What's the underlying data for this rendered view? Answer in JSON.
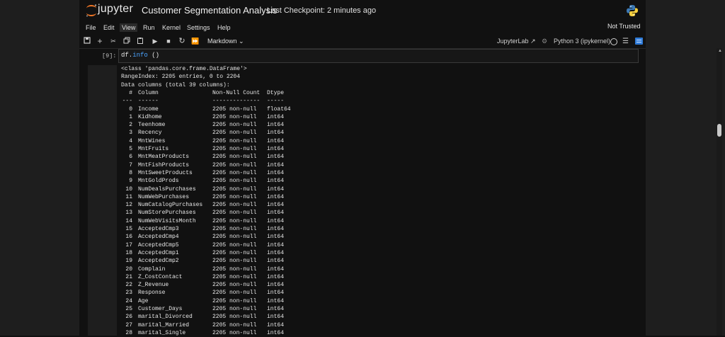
{
  "app": {
    "logo_text": "jupyter",
    "notebook_title": "Customer Segmentation Analysis",
    "checkpoint": "Last Checkpoint: 2 minutes ago"
  },
  "menu": [
    "File",
    "Edit",
    "View",
    "Run",
    "Kernel",
    "Settings",
    "Help"
  ],
  "active_menu": "View",
  "trust_status": "Not Trusted",
  "toolbar": {
    "icons": [
      "save-icon",
      "add-cell-icon",
      "cut-icon",
      "copy-icon",
      "paste-icon",
      "run-icon",
      "stop-icon",
      "restart-icon",
      "fast-forward-icon"
    ],
    "cell_type": "Markdown",
    "jupyterlab_link": "JupyterLab",
    "kernel_name": "Python 3 (ipykernel)"
  },
  "cell": {
    "prompt": "[9]:",
    "code_obj": "df.",
    "code_attr": "info",
    "code_call": " ()"
  },
  "output": {
    "header_lines": [
      "<class 'pandas.core.frame.DataFrame'>",
      "RangeIndex: 2205 entries, 0 to 2204",
      "Data columns (total 39 columns):"
    ],
    "col_header": {
      "num": " #",
      "name": "Column",
      "nn": "Non-Null Count",
      "dtype": "Dtype"
    },
    "col_sep": {
      "num": "---",
      "name": "------",
      "nn": "--------------",
      "dtype": "-----"
    },
    "rows": [
      {
        "num": "0",
        "name": "Income",
        "nn": "2205 non-null",
        "dtype": "float64"
      },
      {
        "num": "1",
        "name": "Kidhome",
        "nn": "2205 non-null",
        "dtype": "int64"
      },
      {
        "num": "2",
        "name": "Teenhome",
        "nn": "2205 non-null",
        "dtype": "int64"
      },
      {
        "num": "3",
        "name": "Recency",
        "nn": "2205 non-null",
        "dtype": "int64"
      },
      {
        "num": "4",
        "name": "MntWines",
        "nn": "2205 non-null",
        "dtype": "int64"
      },
      {
        "num": "5",
        "name": "MntFruits",
        "nn": "2205 non-null",
        "dtype": "int64"
      },
      {
        "num": "6",
        "name": "MntMeatProducts",
        "nn": "2205 non-null",
        "dtype": "int64"
      },
      {
        "num": "7",
        "name": "MntFishProducts",
        "nn": "2205 non-null",
        "dtype": "int64"
      },
      {
        "num": "8",
        "name": "MntSweetProducts",
        "nn": "2205 non-null",
        "dtype": "int64"
      },
      {
        "num": "9",
        "name": "MntGoldProds",
        "nn": "2205 non-null",
        "dtype": "int64"
      },
      {
        "num": "10",
        "name": "NumDealsPurchases",
        "nn": "2205 non-null",
        "dtype": "int64"
      },
      {
        "num": "11",
        "name": "NumWebPurchases",
        "nn": "2205 non-null",
        "dtype": "int64"
      },
      {
        "num": "12",
        "name": "NumCatalogPurchases",
        "nn": "2205 non-null",
        "dtype": "int64"
      },
      {
        "num": "13",
        "name": "NumStorePurchases",
        "nn": "2205 non-null",
        "dtype": "int64"
      },
      {
        "num": "14",
        "name": "NumWebVisitsMonth",
        "nn": "2205 non-null",
        "dtype": "int64"
      },
      {
        "num": "15",
        "name": "AcceptedCmp3",
        "nn": "2205 non-null",
        "dtype": "int64"
      },
      {
        "num": "16",
        "name": "AcceptedCmp4",
        "nn": "2205 non-null",
        "dtype": "int64"
      },
      {
        "num": "17",
        "name": "AcceptedCmp5",
        "nn": "2205 non-null",
        "dtype": "int64"
      },
      {
        "num": "18",
        "name": "AcceptedCmp1",
        "nn": "2205 non-null",
        "dtype": "int64"
      },
      {
        "num": "19",
        "name": "AcceptedCmp2",
        "nn": "2205 non-null",
        "dtype": "int64"
      },
      {
        "num": "20",
        "name": "Complain",
        "nn": "2205 non-null",
        "dtype": "int64"
      },
      {
        "num": "21",
        "name": "Z_CostContact",
        "nn": "2205 non-null",
        "dtype": "int64"
      },
      {
        "num": "22",
        "name": "Z_Revenue",
        "nn": "2205 non-null",
        "dtype": "int64"
      },
      {
        "num": "23",
        "name": "Response",
        "nn": "2205 non-null",
        "dtype": "int64"
      },
      {
        "num": "24",
        "name": "Age",
        "nn": "2205 non-null",
        "dtype": "int64"
      },
      {
        "num": "25",
        "name": "Customer_Days",
        "nn": "2205 non-null",
        "dtype": "int64"
      },
      {
        "num": "26",
        "name": "marital_Divorced",
        "nn": "2205 non-null",
        "dtype": "int64"
      },
      {
        "num": "27",
        "name": "marital_Married",
        "nn": "2205 non-null",
        "dtype": "int64"
      },
      {
        "num": "28",
        "name": "marital_Single",
        "nn": "2205 non-null",
        "dtype": "int64"
      }
    ]
  },
  "colors": {
    "accent": "#2f7bd8",
    "code_attr": "#4aa3ff",
    "logo_orange": "#f37726"
  }
}
